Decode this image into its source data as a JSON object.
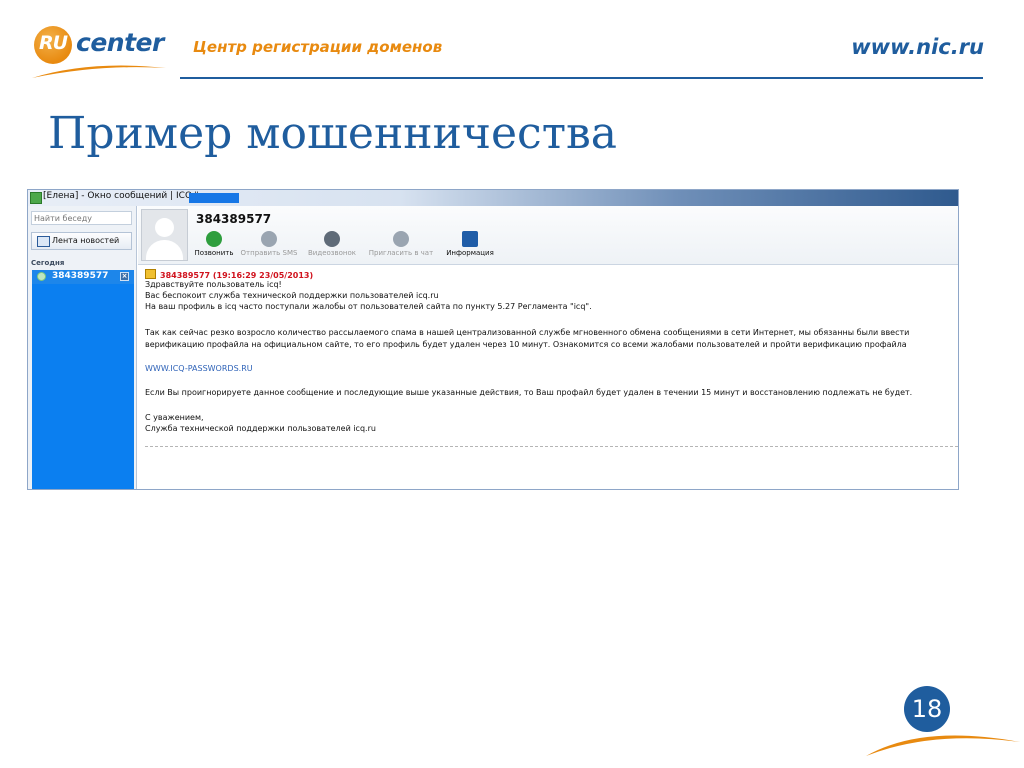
{
  "header": {
    "logo_ru": "RU",
    "logo_center": "center",
    "tagline": "Центр регистрации доменов",
    "site_url": "www.nic.ru"
  },
  "slide": {
    "title": "Пример мошенничества",
    "page_number": "18"
  },
  "icq_window": {
    "title": "[Елена] - Окно сообщений | ICQ#",
    "sidebar": {
      "search_placeholder": "Найти беседу",
      "news_button": "Лента новостей",
      "section_today": "Сегодня",
      "contacts": [
        {
          "name": "384389577",
          "close": "×"
        }
      ]
    },
    "profile": {
      "uin": "384389577",
      "actions": [
        {
          "label": "Позвонить",
          "icon": "phone-icon",
          "enabled": true,
          "color": "#2e9e3e"
        },
        {
          "label": "Отправить SMS",
          "icon": "sms-icon",
          "enabled": false,
          "color": "#9aa5b1"
        },
        {
          "label": "Видеозвонок",
          "icon": "video-icon",
          "enabled": false,
          "color": "#5f6b78"
        },
        {
          "label": "Пригласить в чат",
          "icon": "group-chat-icon",
          "enabled": false,
          "color": "#9aa5b1"
        },
        {
          "label": "Информация",
          "icon": "contact-card-icon",
          "enabled": true,
          "color": "#1f5da8"
        }
      ]
    },
    "message": {
      "header": "384389577 (19:16:29 23/05/2013)",
      "lines": [
        "Здравствуйте пользователь icq!",
        "Вас беспокоит служба технической поддержки пользователей icq.ru",
        "На ваш профиль в icq часто поступали жалобы от пользователей сайта по пункту 5.27 Регламента \"icq\".",
        "",
        "Так как сейчас резко возросло количество рассылаемого спама в нашей централизованной службе мгновенного обмена сообщениями в сети Интернет, мы обязанны были ввести",
        "верификацию профайла на официальном сайте, то его профиль будет удален через 10 минут. Ознакомится со всеми жалобами пользователей и пройти верификацию профайла",
        "",
        "WWW.ICQ-PASSWORDS.RU",
        "",
        "Если Вы проигнорируете данное сообщение и последующие выше указанные действия, то Ваш профайл будет удален в течении 15 минут и восстановлению подлежать не будет.",
        "",
        "С уважением,",
        "Служба технической поддержки пользователей icq.ru"
      ]
    }
  },
  "colors": {
    "brand_blue": "#1f5d9e",
    "brand_orange": "#e88a10",
    "message_header_red": "#d0121d",
    "link_blue": "#2f63b8",
    "contact_selected": "#0b7ff0"
  }
}
